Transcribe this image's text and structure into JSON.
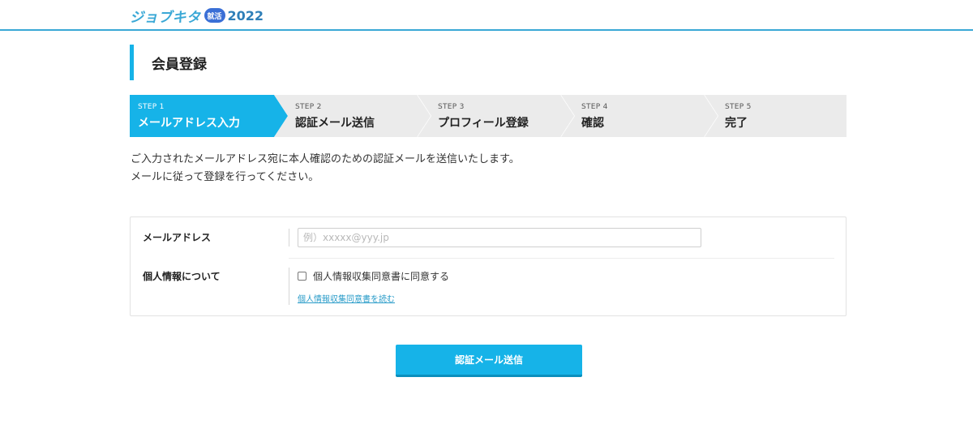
{
  "header": {
    "logo_text": "ジョブキタ",
    "logo_badge": "就活",
    "logo_year": "2022"
  },
  "page": {
    "title": "会員登録"
  },
  "steps": [
    {
      "num": "STEP 1",
      "label": "メールアドレス入力",
      "active": true
    },
    {
      "num": "STEP 2",
      "label": "認証メール送信",
      "active": false
    },
    {
      "num": "STEP 3",
      "label": "プロフィール登録",
      "active": false
    },
    {
      "num": "STEP 4",
      "label": "確認",
      "active": false
    },
    {
      "num": "STEP 5",
      "label": "完了",
      "active": false
    }
  ],
  "description": {
    "line1": "ご入力されたメールアドレス宛に本人確認のための認証メールを送信いたします。",
    "line2": "メールに従って登録を行ってください。"
  },
  "form": {
    "email_label": "メールアドレス",
    "email_placeholder": "例）xxxxx@yyy.jp",
    "email_value": "",
    "privacy_label": "個人情報について",
    "agree_text": "個人情報収集同意書に同意する",
    "agree_checked": false,
    "read_link": "個人情報収集同意書を読む"
  },
  "submit": {
    "label": "認証メール送信"
  },
  "colors": {
    "accent": "#16b3e8",
    "step_inactive": "#ebebeb",
    "header_line": "#3aa8d6",
    "link": "#2a9cc9"
  }
}
